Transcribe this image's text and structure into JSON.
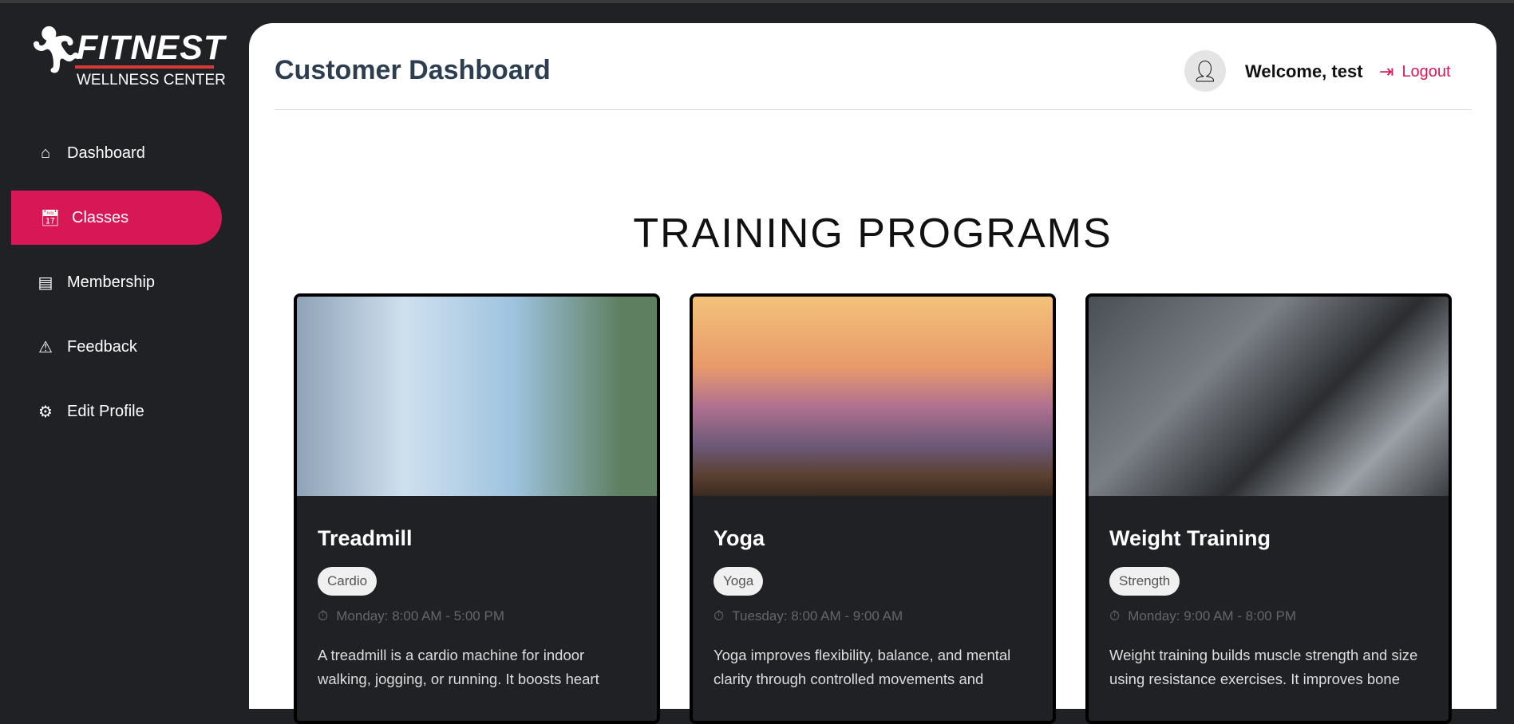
{
  "brand": {
    "name": "FITNEST",
    "subtitle": "WELLNESS CENTER"
  },
  "sidebar": {
    "items": [
      {
        "label": "Dashboard",
        "icon": "home-icon",
        "active": false
      },
      {
        "label": "Classes",
        "icon": "calendar-check-icon",
        "active": true
      },
      {
        "label": "Membership",
        "icon": "id-card-icon",
        "active": false
      },
      {
        "label": "Feedback",
        "icon": "feedback-icon",
        "active": false
      },
      {
        "label": "Edit Profile",
        "icon": "user-gear-icon",
        "active": false
      }
    ]
  },
  "header": {
    "title": "Customer Dashboard",
    "welcome": "Welcome, test",
    "logout": "Logout"
  },
  "main": {
    "section_title": "TRAINING PROGRAMS",
    "cards": [
      {
        "title": "Treadmill",
        "tag": "Cardio",
        "schedule": "Monday: 8:00 AM - 5:00 PM",
        "description": "A treadmill is a cardio machine for indoor walking, jogging, or running. It boosts heart"
      },
      {
        "title": "Yoga",
        "tag": "Yoga",
        "schedule": "Tuesday: 8:00 AM - 9:00 AM",
        "description": "Yoga improves flexibility, balance, and mental clarity through controlled movements and"
      },
      {
        "title": "Weight Training",
        "tag": "Strength",
        "schedule": "Monday: 9:00 AM - 8:00 PM",
        "description": "Weight training builds muscle strength and size using resistance exercises. It improves bone"
      }
    ]
  },
  "colors": {
    "accent": "#d81756",
    "sidebar": "#202125",
    "title": "#2c3e50"
  }
}
